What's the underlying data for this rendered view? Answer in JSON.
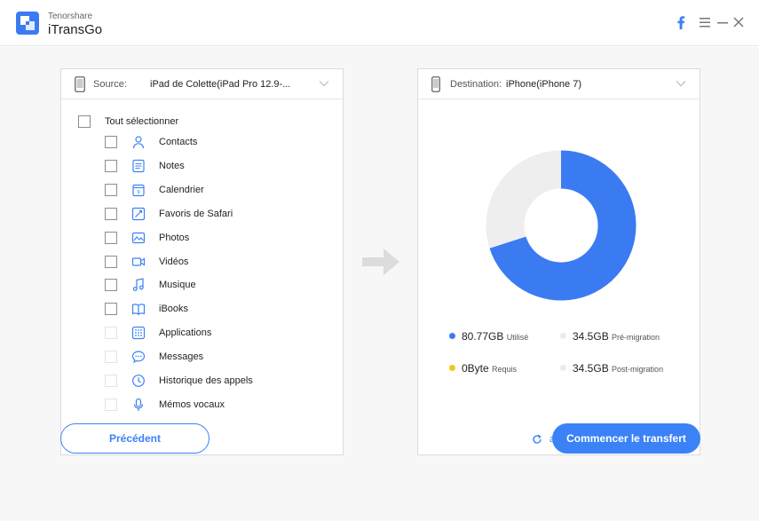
{
  "app": {
    "vendor": "Tenorshare",
    "name": "iTransGo"
  },
  "window_controls": [
    "facebook-icon",
    "menu-icon",
    "minimize-icon",
    "close-icon"
  ],
  "source": {
    "label": "Source:",
    "device": "iPad de Colette(iPad Pro 12.9-...",
    "select_all": "Tout sélectionner",
    "items": [
      {
        "label": "Contacts",
        "icon": "contacts-icon",
        "enabled": true
      },
      {
        "label": "Notes",
        "icon": "notes-icon",
        "enabled": true
      },
      {
        "label": "Calendrier",
        "icon": "calendar-icon",
        "enabled": true
      },
      {
        "label": "Favoris de Safari",
        "icon": "safari-bookmarks-icon",
        "enabled": true
      },
      {
        "label": "Photos",
        "icon": "photos-icon",
        "enabled": true
      },
      {
        "label": "Vidéos",
        "icon": "videos-icon",
        "enabled": true
      },
      {
        "label": "Musique",
        "icon": "music-icon",
        "enabled": true
      },
      {
        "label": "iBooks",
        "icon": "ibooks-icon",
        "enabled": true
      },
      {
        "label": "Applications",
        "icon": "applications-icon",
        "enabled": false
      },
      {
        "label": "Messages",
        "icon": "messages-icon",
        "enabled": false
      },
      {
        "label": "Historique des appels",
        "icon": "call-history-icon",
        "enabled": false
      },
      {
        "label": "Mémos vocaux",
        "icon": "voice-memos-icon",
        "enabled": false
      }
    ]
  },
  "destination": {
    "label": "Destination:",
    "device": "iPhone(iPhone 7)",
    "used_fraction": 0.7007,
    "stats": [
      {
        "value": "80.77GB",
        "label": "Utilisé",
        "color": "#3b7bf2"
      },
      {
        "value": "34.5GB",
        "label": "Pré-migration",
        "color": "#ebebeb"
      },
      {
        "value": "0Byte",
        "label": "Requis",
        "color": "#f5c518"
      },
      {
        "value": "34.5GB",
        "label": "Post-migration",
        "color": "#ebebeb"
      }
    ],
    "refresh": "actualiser"
  },
  "buttons": {
    "previous": "Précédent",
    "start": "Commencer le transfert"
  },
  "colors": {
    "accent": "#3b82f6",
    "used": "#3b7bf2",
    "free": "#eeeeee"
  }
}
